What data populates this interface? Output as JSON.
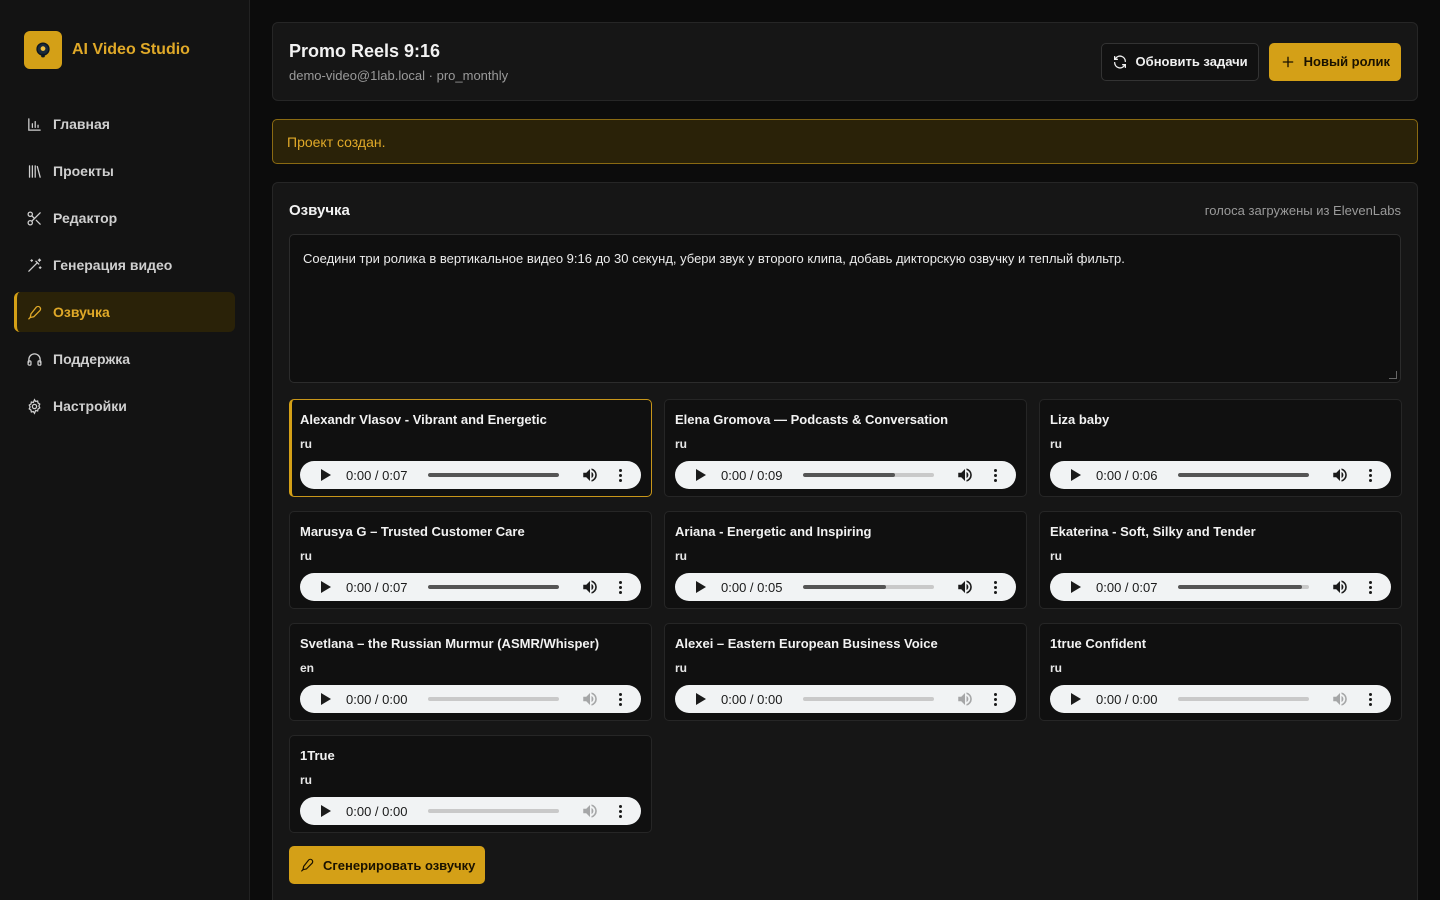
{
  "brand": {
    "name": "AI Video Studio"
  },
  "nav": [
    {
      "label": "Главная",
      "icon": "chart-icon",
      "active": false
    },
    {
      "label": "Проекты",
      "icon": "library-icon",
      "active": false
    },
    {
      "label": "Редактор",
      "icon": "scissors-icon",
      "active": false
    },
    {
      "label": "Генерация видео",
      "icon": "magic-wand-icon",
      "active": false
    },
    {
      "label": "Озвучка",
      "icon": "microphone-icon",
      "active": true
    },
    {
      "label": "Поддержка",
      "icon": "headphones-icon",
      "active": false
    },
    {
      "label": "Настройки",
      "icon": "gear-icon",
      "active": false
    }
  ],
  "header": {
    "title": "Promo Reels 9:16",
    "subtitle": "demo-video@1lab.local · pro_monthly",
    "refresh_label": "Обновить задачи",
    "new_label": "Новый ролик"
  },
  "alert": {
    "text": "Проект создан."
  },
  "voiceover": {
    "title": "Озвучка",
    "note": "голоса загружены из ElevenLabs",
    "prompt": "Соедини три ролика в вертикальное видео 9:16 до 30 секунд, убери звук у второго клипа, добавь дикторскую озвучку и теплый фильтр.",
    "voices": [
      {
        "name": "Alexandr Vlasov - Vibrant and Energetic",
        "lang": "ru",
        "time": "0:00 / 0:07",
        "selected": true,
        "buffered": 1.0
      },
      {
        "name": "Elena Gromova — Podcasts & Conversation",
        "lang": "ru",
        "time": "0:00 / 0:09",
        "selected": false,
        "buffered": 0.7
      },
      {
        "name": "Liza baby",
        "lang": "ru",
        "time": "0:00 / 0:06",
        "selected": false,
        "buffered": 1.0
      },
      {
        "name": "Marusya G – Trusted Customer Care",
        "lang": "ru",
        "time": "0:00 / 0:07",
        "selected": false,
        "buffered": 1.0
      },
      {
        "name": "Ariana - Energetic and Inspiring",
        "lang": "ru",
        "time": "0:00 / 0:05",
        "selected": false,
        "buffered": 0.63
      },
      {
        "name": "Ekaterina - Soft, Silky and Tender",
        "lang": "ru",
        "time": "0:00 / 0:07",
        "selected": false,
        "buffered": 0.95
      },
      {
        "name": "Svetlana – the Russian Murmur (ASMR/Whisper)",
        "lang": "en",
        "time": "0:00 / 0:00",
        "selected": false,
        "buffered": 0
      },
      {
        "name": "Alexei – Eastern European Business Voice",
        "lang": "ru",
        "time": "0:00 / 0:00",
        "selected": false,
        "buffered": 0
      },
      {
        "name": "1true Confident",
        "lang": "ru",
        "time": "0:00 / 0:00",
        "selected": false,
        "buffered": 0
      },
      {
        "name": "1True",
        "lang": "ru",
        "time": "0:00 / 0:00",
        "selected": false,
        "buffered": 0
      }
    ],
    "generate_label": "Сгенерировать озвучку"
  },
  "colors": {
    "accent": "#d4a017",
    "accent_text": "#e0a928",
    "bg": "#0c0c0c",
    "panel": "#161616"
  }
}
